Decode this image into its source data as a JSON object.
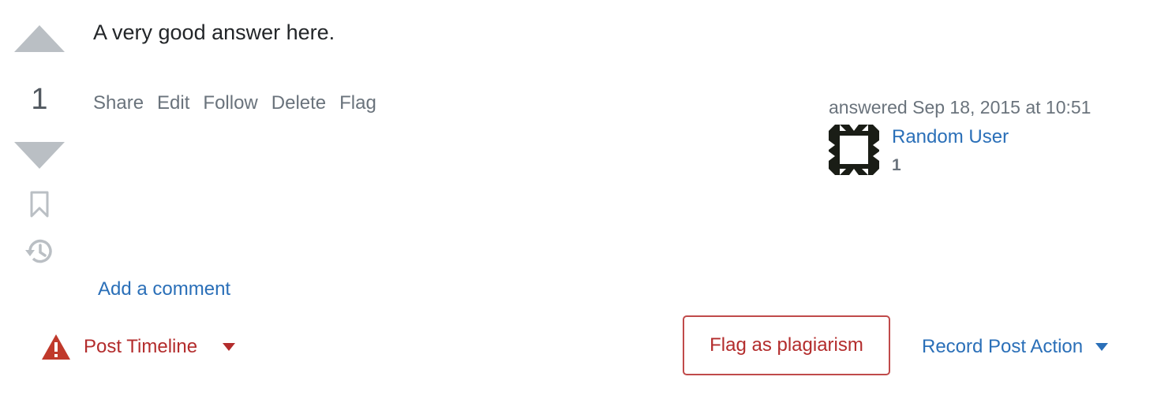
{
  "post": {
    "text": "A very good answer here.",
    "score": "1"
  },
  "menu": [
    "Share",
    "Edit",
    "Follow",
    "Delete",
    "Flag"
  ],
  "user_card": {
    "action": "answered Sep 18, 2015 at 10:51",
    "name": "Random User",
    "reputation": "1"
  },
  "comments": {
    "add_label": "Add a comment"
  },
  "footer": {
    "timeline_label": "Post Timeline",
    "flag_label": "Flag as plagiarism",
    "record_label": "Record Post Action"
  },
  "colors": {
    "link": "#2a6fb8",
    "danger": "#b32c2c",
    "muted": "#6a737c",
    "vote_arrow": "#babfc4"
  },
  "icons": {
    "vote_up": "triangle-up-icon",
    "vote_down": "triangle-down-icon",
    "bookmark": "bookmark-icon",
    "history": "history-icon",
    "timeline": "warning-icon",
    "dropdown": "caret-down-icon",
    "avatar": "identicon"
  }
}
